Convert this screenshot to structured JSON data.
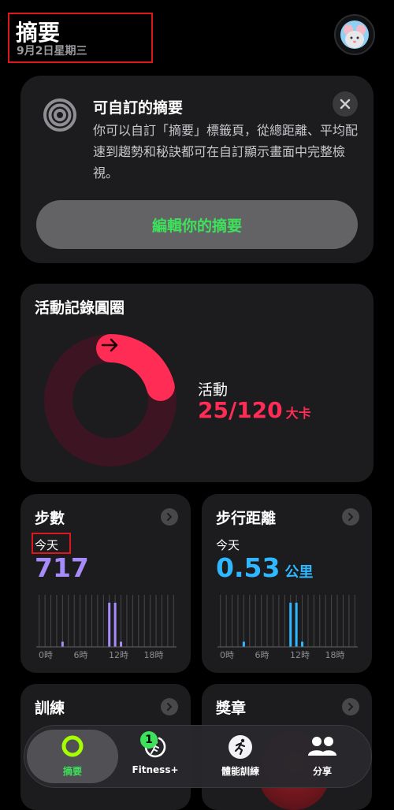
{
  "header": {
    "title": "摘要",
    "date": "9月2日星期三"
  },
  "customize_card": {
    "title": "可自訂的摘要",
    "body": "你可以自訂「摘要」標籤頁，從總距離、平均配速到趨勢和秘訣都可在自訂顯示畫面中完整檢視。",
    "button_label": "編輯你的摘要",
    "icon": "activity-rings-icon",
    "close_icon": "close-icon"
  },
  "rings_card": {
    "title": "活動記錄圓圈",
    "label": "活動",
    "value": "25/120",
    "unit": "大卡",
    "progress_fraction": 0.2083,
    "color": "#ff2d55"
  },
  "steps_card": {
    "title": "步數",
    "period": "今天",
    "value": "717",
    "axis_labels": [
      "0時",
      "6時",
      "12時",
      "18時"
    ],
    "hourly_fraction": [
      0,
      0,
      0,
      0,
      0.1,
      0,
      0,
      0,
      0,
      0,
      0,
      0,
      0.85,
      0.85,
      0.1,
      0,
      0,
      0,
      0,
      0,
      0,
      0,
      0,
      0
    ],
    "color": "#a78bfa"
  },
  "distance_card": {
    "title": "步行距離",
    "period": "今天",
    "value": "0.53",
    "unit": "公里",
    "axis_labels": [
      "0時",
      "6時",
      "12時",
      "18時"
    ],
    "hourly_fraction": [
      0,
      0,
      0,
      0,
      0.1,
      0,
      0,
      0,
      0,
      0,
      0,
      0,
      0.85,
      0.85,
      0.1,
      0,
      0,
      0,
      0,
      0,
      0,
      0,
      0,
      0
    ],
    "color": "#2fb8ff"
  },
  "workouts_card": {
    "title": "訓練"
  },
  "awards_card": {
    "title": "獎章"
  },
  "tabbar": {
    "tabs": [
      {
        "label": "摘要",
        "icon": "activity-ring-icon",
        "active": true
      },
      {
        "label": "Fitness+",
        "icon": "fitness-plus-icon"
      },
      {
        "label": "體能訓練",
        "icon": "running-figure-icon"
      },
      {
        "label": "分享",
        "icon": "people-icon"
      }
    ],
    "fitness_badge": "1"
  }
}
